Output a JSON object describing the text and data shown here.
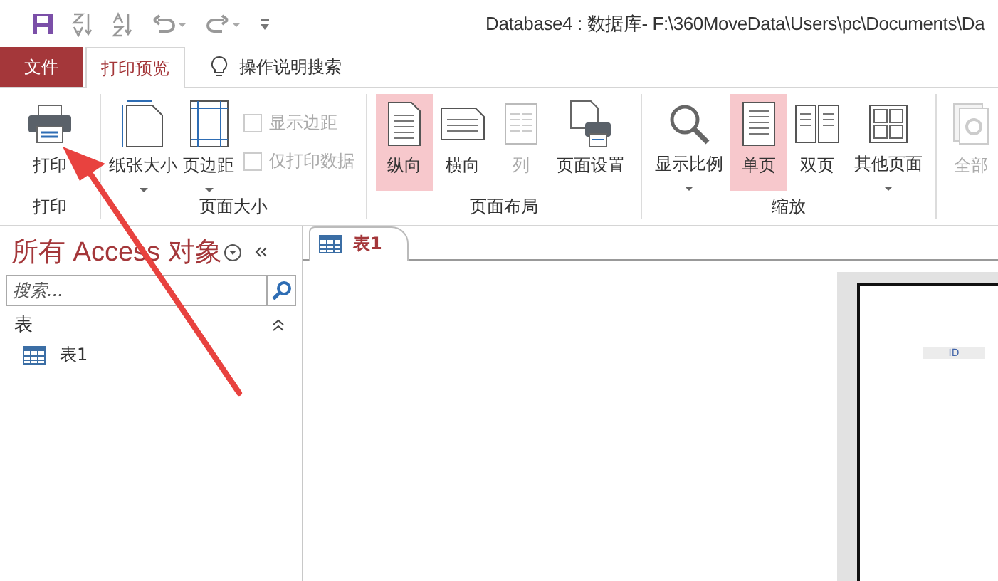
{
  "title_bar": {
    "title": "Database4 : 数据库- F:\\360MoveData\\Users\\pc\\Documents\\Da"
  },
  "tabs": [
    {
      "label": "文件",
      "kind": "file",
      "selected": false
    },
    {
      "label": "打印预览",
      "kind": "tab",
      "selected": true
    },
    {
      "label": "操作说明搜索",
      "kind": "search",
      "selected": false
    }
  ],
  "ribbon": {
    "groups": [
      {
        "label": "打印",
        "items": [
          {
            "label": "打印",
            "kind": "large",
            "selected": false,
            "disabled": false,
            "dropdown": false
          }
        ]
      },
      {
        "label": "页面大小",
        "items": [
          {
            "label": "纸张大小",
            "kind": "large",
            "selected": false,
            "disabled": false,
            "dropdown": true
          },
          {
            "label": "页边距",
            "kind": "large",
            "selected": false,
            "disabled": false,
            "dropdown": true
          },
          {
            "label": "显示边距",
            "kind": "checkbox",
            "checked": false,
            "disabled": true
          },
          {
            "label": "仅打印数据",
            "kind": "checkbox",
            "checked": false,
            "disabled": true
          }
        ]
      },
      {
        "label": "页面布局",
        "items": [
          {
            "label": "纵向",
            "kind": "large",
            "selected": true,
            "disabled": false,
            "dropdown": false
          },
          {
            "label": "横向",
            "kind": "large",
            "selected": false,
            "disabled": false,
            "dropdown": false
          },
          {
            "label": "列",
            "kind": "large",
            "selected": false,
            "disabled": true,
            "dropdown": false
          },
          {
            "label": "页面设置",
            "kind": "large",
            "selected": false,
            "disabled": false,
            "dropdown": false
          }
        ]
      },
      {
        "label": "缩放",
        "items": [
          {
            "label": "显示比例",
            "kind": "large",
            "selected": false,
            "disabled": false,
            "dropdown": true
          },
          {
            "label": "单页",
            "kind": "large",
            "selected": true,
            "disabled": false,
            "dropdown": false
          },
          {
            "label": "双页",
            "kind": "large",
            "selected": false,
            "disabled": false,
            "dropdown": false
          },
          {
            "label": "其他页面",
            "kind": "large",
            "selected": false,
            "disabled": false,
            "dropdown": true
          }
        ]
      },
      {
        "items": [
          {
            "label": "全部",
            "kind": "large",
            "selected": false,
            "disabled": true,
            "dropdown": false
          }
        ]
      }
    ]
  },
  "navigation_pane": {
    "title": "所有 Access 对象",
    "search": {
      "placeholder": "搜索..."
    },
    "sections": [
      {
        "label": "表",
        "expanded": true,
        "items": [
          {
            "label": "表1"
          }
        ]
      }
    ]
  },
  "document_tabs": [
    {
      "label": "表1",
      "selected": true
    }
  ],
  "preview": {
    "field_label": "ID"
  }
}
